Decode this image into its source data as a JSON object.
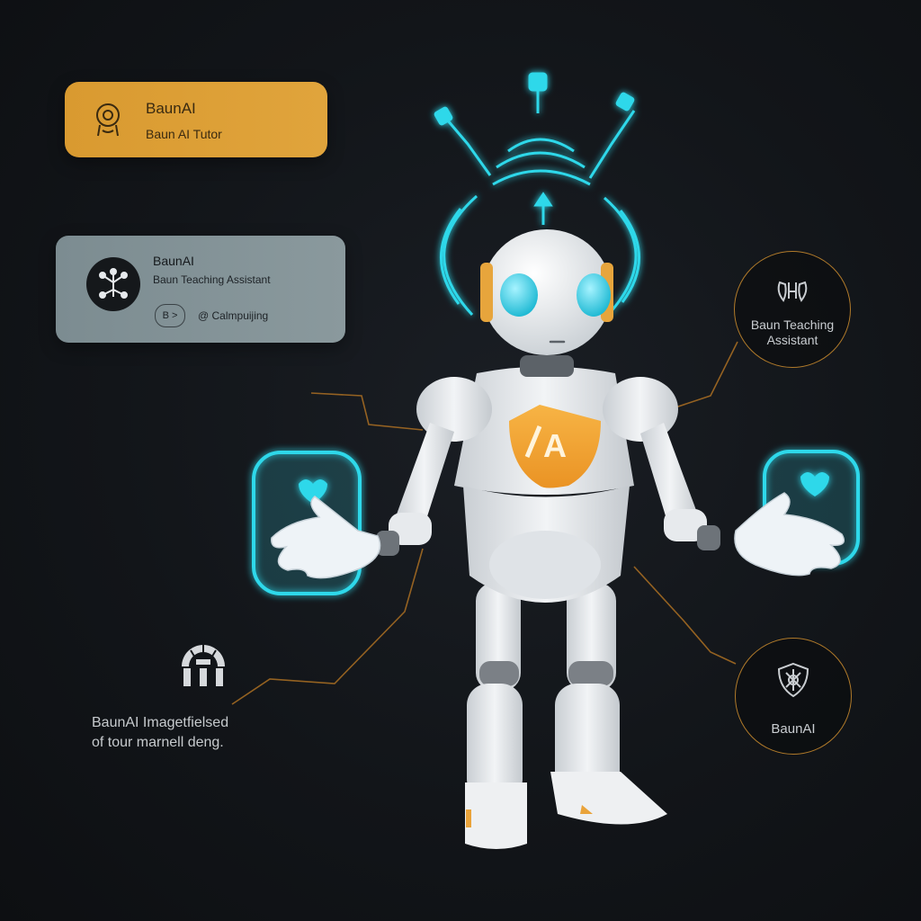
{
  "cards": {
    "tutor": {
      "title": "BaunAI",
      "subtitle": "Baun AI Tutor",
      "icon": "brain-head-icon",
      "color": "#de9f37"
    },
    "assistant": {
      "title": "BaunAI",
      "subtitle": "Baun Teaching Assistant",
      "icon": "network-avatar-icon",
      "pill_label": "B >",
      "tag_label": "@ Calmpuijing",
      "color": "#84949a"
    }
  },
  "badges": {
    "top": {
      "label_line1": "Baun Teaching",
      "label_line2": "Assistant",
      "icon": "heart-hands-icon"
    },
    "bottom": {
      "label": "BaunAI",
      "icon": "shield-network-icon"
    }
  },
  "caption": {
    "line1": "BaunAI Imagetfielsed",
    "line2": "of tour marnell deng.",
    "icon": "arch-fan-icon"
  },
  "robot": {
    "chest_logo": "A",
    "accent_color": "#33d6e6",
    "logo_color": "#f2a531"
  }
}
